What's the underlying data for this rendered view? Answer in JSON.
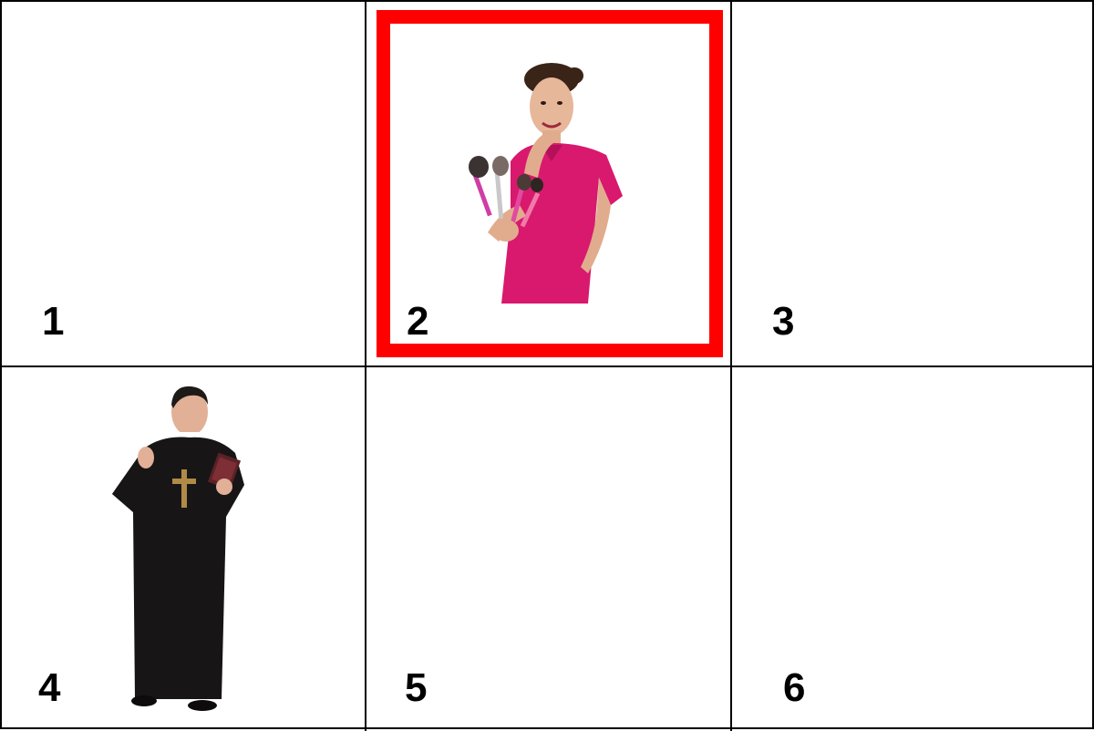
{
  "cells": [
    {
      "number": "1",
      "content": ""
    },
    {
      "number": "2",
      "content": "woman-with-makeup-brushes",
      "selected": true
    },
    {
      "number": "3",
      "content": ""
    },
    {
      "number": "4",
      "content": "priest-in-black-robe"
    },
    {
      "number": "5",
      "content": ""
    },
    {
      "number": "6",
      "content": ""
    }
  ],
  "colors": {
    "grid_lines": "#000000",
    "selection_border": "#ff0000",
    "background": "#ffffff"
  }
}
